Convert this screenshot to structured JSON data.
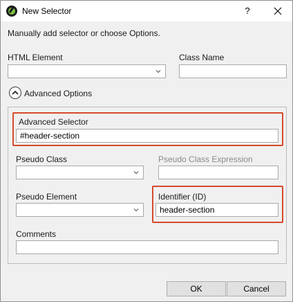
{
  "window": {
    "title": "New Selector",
    "help_label": "?"
  },
  "intro_text": "Manually add selector or choose Options.",
  "fields": {
    "html_element": {
      "label": "HTML Element",
      "value": ""
    },
    "class_name": {
      "label": "Class Name",
      "value": ""
    },
    "advanced_options": {
      "label": "Advanced Options",
      "expanded": true
    },
    "advanced_selector": {
      "label": "Advanced Selector",
      "value": "#header-section",
      "highlighted": true
    },
    "pseudo_class": {
      "label": "Pseudo Class",
      "value": ""
    },
    "pseudo_class_expression": {
      "label": "Pseudo Class Expression",
      "value": "",
      "disabled": true
    },
    "pseudo_element": {
      "label": "Pseudo Element",
      "value": ""
    },
    "identifier": {
      "label": "Identifier (ID)",
      "value": "header-section",
      "highlighted": true
    },
    "comments": {
      "label": "Comments",
      "value": ""
    }
  },
  "buttons": {
    "ok": "OK",
    "cancel": "Cancel"
  },
  "colors": {
    "highlight": "#d64a2c",
    "app_icon": "#7cc242",
    "dialog_bg": "#f0f0f0"
  },
  "icons": [
    "app-logo-icon",
    "help-icon",
    "close-icon",
    "chevron-down-icon",
    "chevron-up-icon"
  ]
}
